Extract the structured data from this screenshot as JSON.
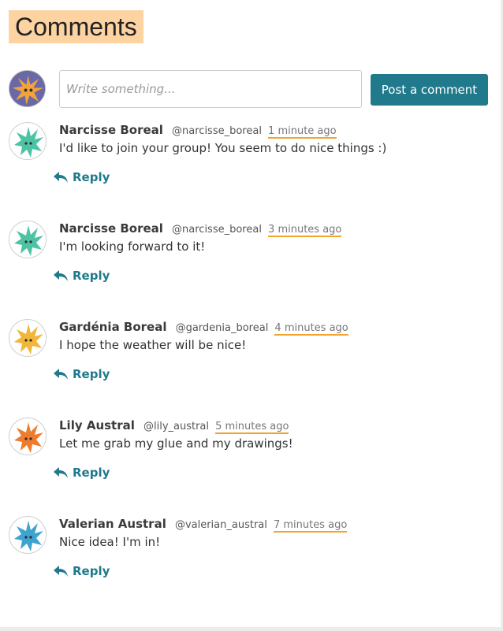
{
  "header": {
    "title": "Comments"
  },
  "composer": {
    "placeholder": "Write something...",
    "post_label": "Post a comment",
    "avatar_icon": "purple-leaf-creature-icon"
  },
  "comments": [
    {
      "name": "Narcisse Boreal",
      "handle": "@narcisse_boreal",
      "time": "1 minute ago",
      "text": "I'd like to join your group! You seem to do nice things :)",
      "reply_label": "Reply",
      "avatar_color": "#4cc3a3",
      "avatar_icon": "green-leaf-creature-icon"
    },
    {
      "name": "Narcisse Boreal",
      "handle": "@narcisse_boreal",
      "time": "3 minutes ago",
      "text": "I'm looking forward to it!",
      "reply_label": "Reply",
      "avatar_color": "#4cc3a3",
      "avatar_icon": "green-leaf-creature-icon"
    },
    {
      "name": "Gardénia Boreal",
      "handle": "@gardenia_boreal",
      "time": "4 minutes ago",
      "text": "I hope the weather will be nice!",
      "reply_label": "Reply",
      "avatar_color": "#f2b63a",
      "avatar_icon": "yellow-leaf-creature-icon"
    },
    {
      "name": "Lily Austral",
      "handle": "@lily_austral",
      "time": "5 minutes ago",
      "text": "Let me grab my glue and my drawings!",
      "reply_label": "Reply",
      "avatar_color": "#ef7b2e",
      "avatar_icon": "orange-leaf-creature-icon"
    },
    {
      "name": "Valerian Austral",
      "handle": "@valerian_austral",
      "time": "7 minutes ago",
      "text": "Nice idea! I'm in!",
      "reply_label": "Reply",
      "avatar_color": "#3fa3cf",
      "avatar_icon": "blue-leaf-creature-icon"
    }
  ]
}
